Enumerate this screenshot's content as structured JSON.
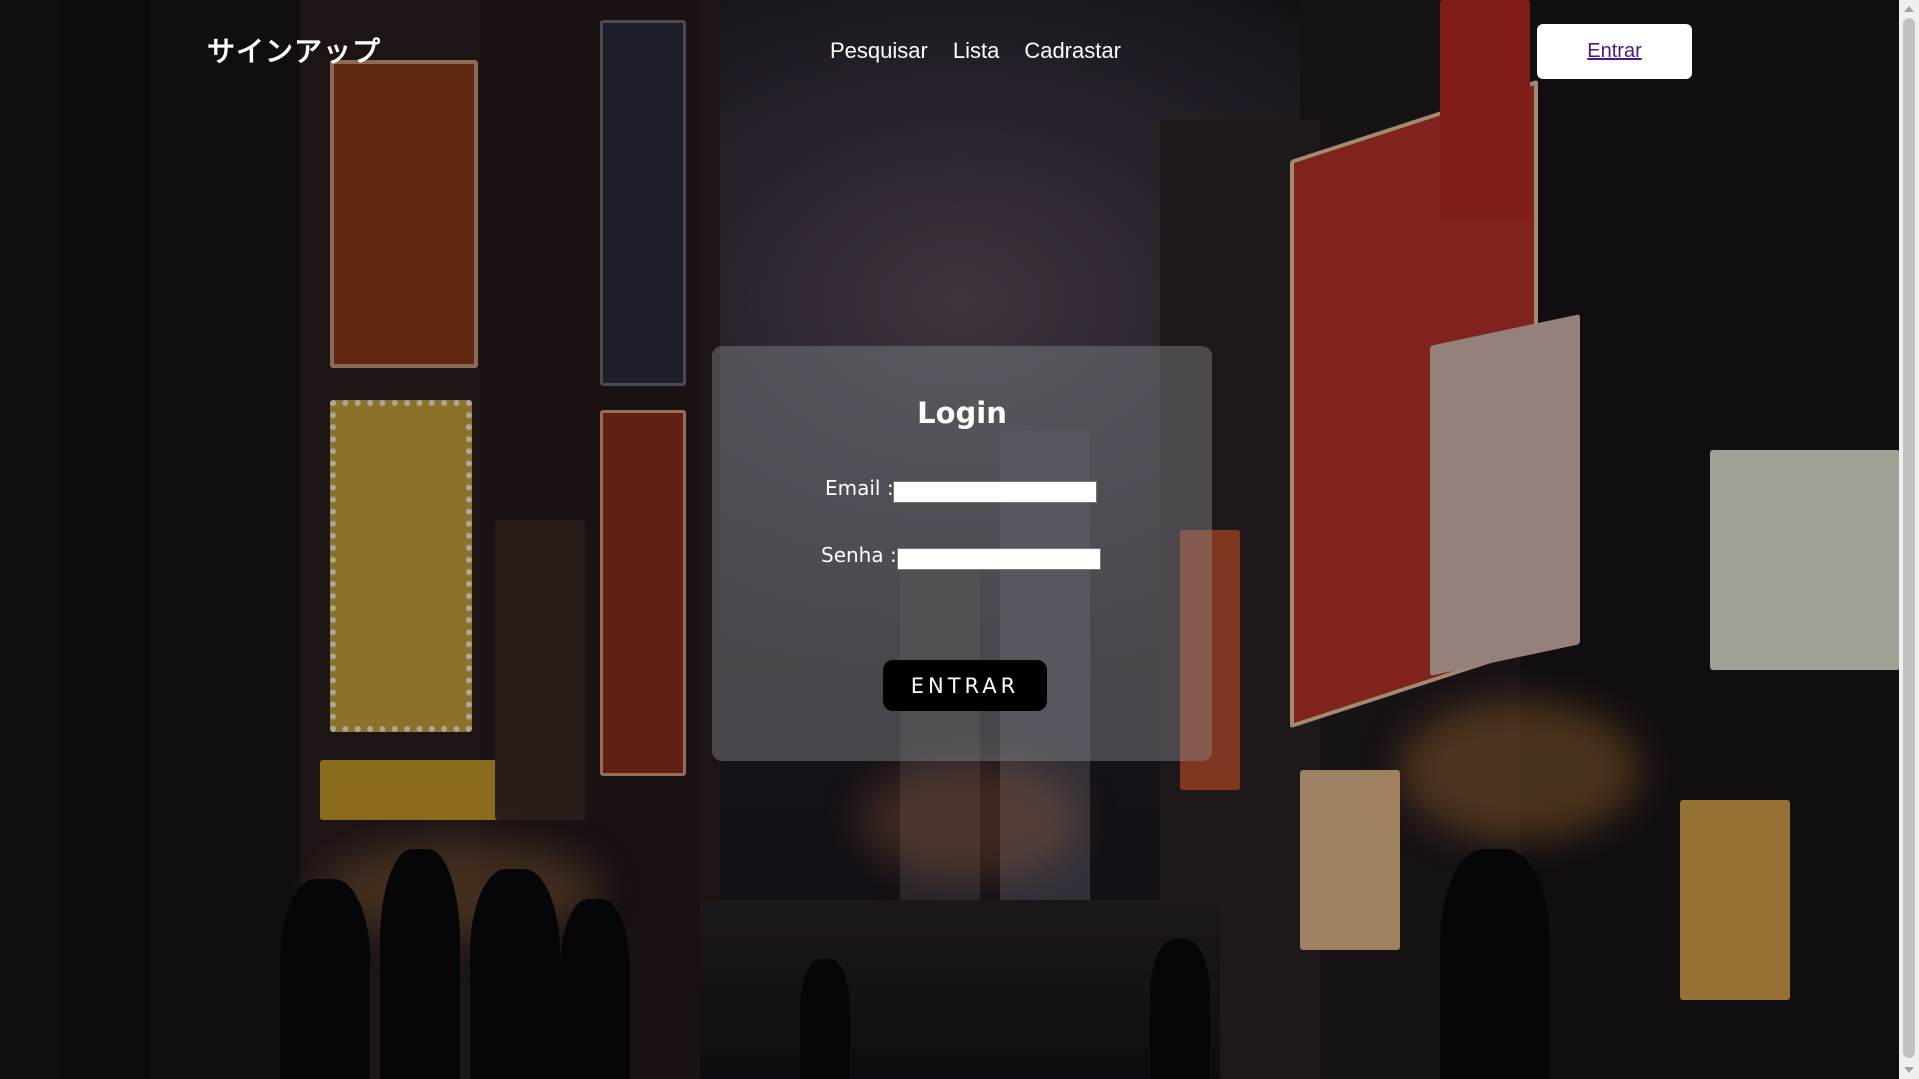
{
  "header": {
    "logo_text": "サインアップ",
    "nav_items": [
      {
        "label": "Pesquisar"
      },
      {
        "label": "Lista"
      },
      {
        "label": "Cadrastar"
      }
    ],
    "enter_button_label": "Entrar"
  },
  "login": {
    "title": "Login",
    "email_label": "Email :",
    "email_value": "",
    "password_label": "Senha :",
    "password_value": "",
    "submit_label": "ENTRAR"
  },
  "colors": {
    "enter_button_text": "#4b1a86",
    "card_background": "rgba(140,140,145,0.42)",
    "submit_button": "#000000"
  }
}
